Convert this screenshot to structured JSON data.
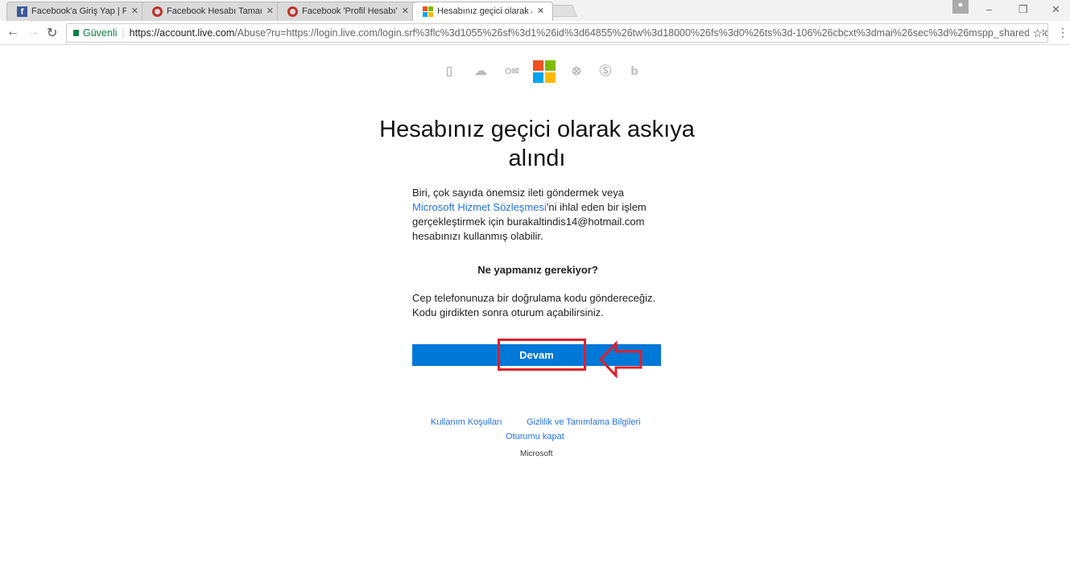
{
  "browser": {
    "tabs": [
      {
        "title": "Facebook'a Giriş Yap | Fa",
        "icon": "facebook-icon"
      },
      {
        "title": "Facebook Hesabı Tamam",
        "icon": "opera-icon"
      },
      {
        "title": "Facebook 'Profil Hesabı'",
        "icon": "opera-icon"
      },
      {
        "title": "Hesabınız geçici olarak a",
        "icon": "microsoft-icon"
      }
    ],
    "secure_label": "Güvenli",
    "url_host": "https://account.live.com",
    "url_rest": "/Abuse?ru=https://login.live.com/login.srf%3flc%3d1055%26sf%3d1%26id%3d64855%26tw%3d18000%26fs%3d0%26ts%3d-106%26cbcxt%3dmai%26sec%3d%26mspp_shared%3d1%2"
  },
  "page": {
    "title": "Hesabınız geçici olarak askıya alındı",
    "p1_a": "Biri, çok sayıda önemsiz ileti göndermek veya ",
    "p1_link": "Microsoft Hizmet Sözleşmesi",
    "p1_b": "'ni ihlal eden bir işlem gerçekleştirmek için burakaltindis14@hotmail.com hesabınızı kullanmış olabilir.",
    "heading": "Ne yapmanız gerekiyor?",
    "p2": "Cep telefonunuza bir doğrulama kodu göndereceğiz. Kodu girdikten sonra oturum açabilirsiniz.",
    "button": "Devam",
    "footer": {
      "terms": "Kullanım Koşulları",
      "privacy": "Gizlilik ve Tanımlama Bilgileri",
      "signout": "Oturumu kapat",
      "brand": "Microsoft"
    }
  },
  "colors": {
    "accent": "#0078d7",
    "highlight": "#e0202a"
  }
}
